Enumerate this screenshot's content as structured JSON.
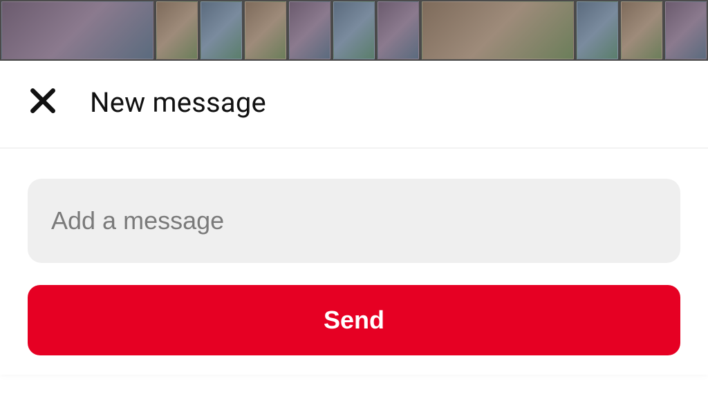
{
  "header": {
    "title": "New message"
  },
  "compose": {
    "placeholder": "Add a message",
    "value": ""
  },
  "actions": {
    "send_label": "Send"
  },
  "colors": {
    "accent": "#e60023",
    "input_bg": "#efefef"
  }
}
